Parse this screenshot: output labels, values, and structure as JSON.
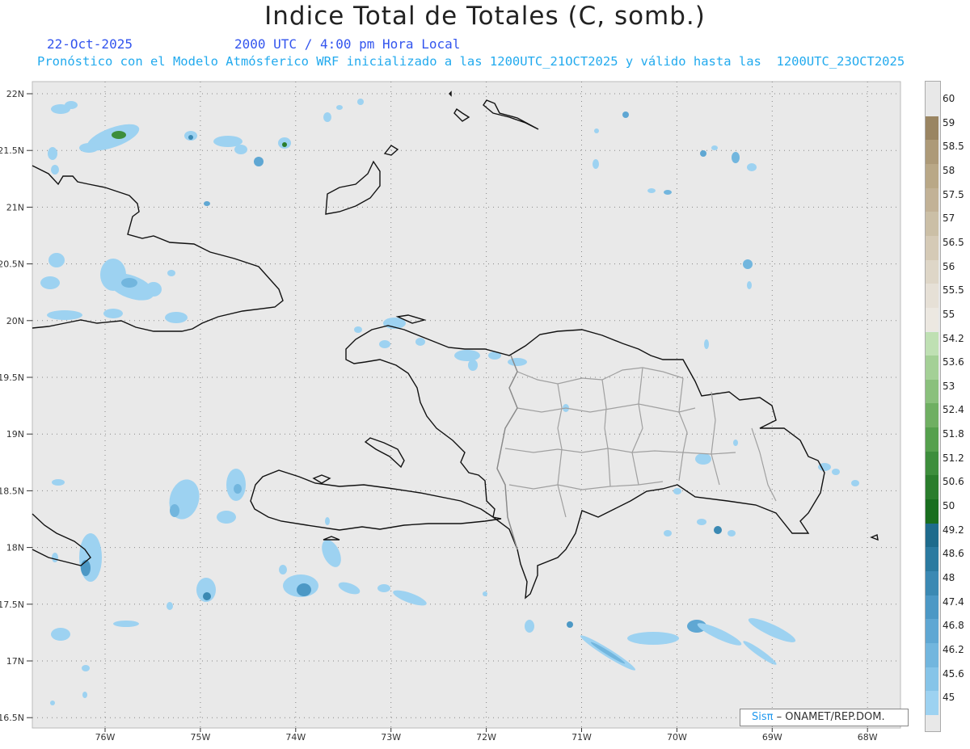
{
  "header": {
    "title": "Indice Total de Totales (C, somb.)",
    "date": "22-Oct-2025",
    "time": "2000 UTC / 4:00 pm Hora Local",
    "description": "Pronóstico con el Modelo Atmósferico WRF inicializado a las 1200UTC_21OCT2025 y válido hasta las  1200UTC_23OCT2025"
  },
  "axes": {
    "lat_labels": [
      "22N",
      "21.5N",
      "21N",
      "20.5N",
      "20N",
      "19.5N",
      "19N",
      "18.5N",
      "18N",
      "17.5N",
      "17N",
      "16.5N"
    ],
    "lon_labels": [
      "76W",
      "75W",
      "74W",
      "73W",
      "72W",
      "71W",
      "70W",
      "69W",
      "68W"
    ]
  },
  "legend": {
    "labels": [
      "60",
      "59",
      "58.5",
      "58",
      "57.5",
      "57",
      "56.5",
      "56",
      "55.5",
      "55",
      "54.2",
      "53.6",
      "53",
      "52.4",
      "51.8",
      "51.2",
      "50.6",
      "50",
      "49.2",
      "48.6",
      "48",
      "47.4",
      "46.8",
      "46.2",
      "45.6",
      "45"
    ],
    "colors": [
      "#e8e8e8",
      "#9a8562",
      "#ad9a78",
      "#b9a887",
      "#c2b296",
      "#cbbfa6",
      "#d5cab6",
      "#ded6c7",
      "#e6e0d6",
      "#ece8e1",
      "#bfe0b3",
      "#a4d096",
      "#8ac07c",
      "#6faf62",
      "#55a04d",
      "#3d8e3c",
      "#2a7d2c",
      "#196e1f",
      "#1e6b8c",
      "#2b7aa0",
      "#3b89b3",
      "#4c98c5",
      "#5fa7d3",
      "#72b6de",
      "#86c4e8",
      "#9dd2f1"
    ]
  },
  "credit": {
    "logo": "Sisπ",
    "org": "– ONAMET/REP.DOM."
  }
}
